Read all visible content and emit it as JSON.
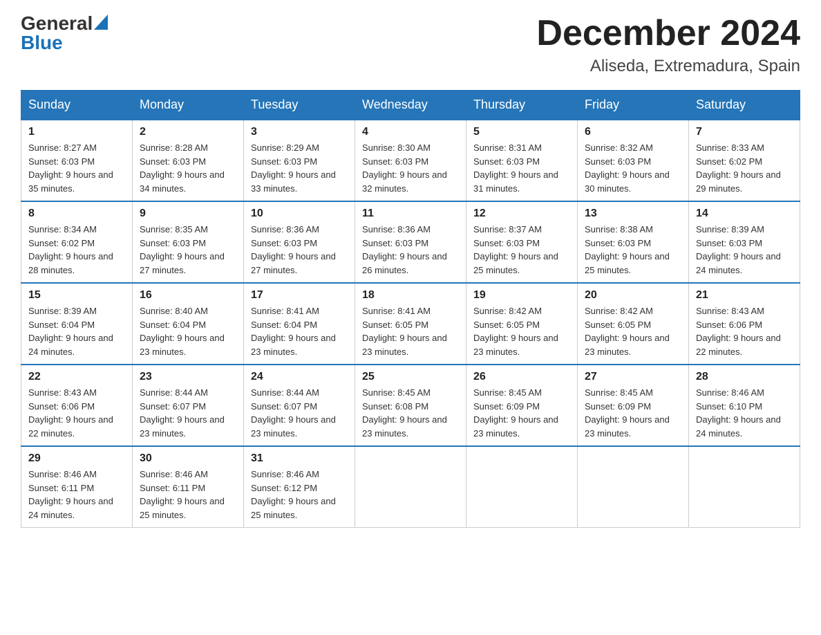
{
  "header": {
    "logo_general": "General",
    "logo_blue": "Blue",
    "month_title": "December 2024",
    "location": "Aliseda, Extremadura, Spain"
  },
  "days_of_week": [
    "Sunday",
    "Monday",
    "Tuesday",
    "Wednesday",
    "Thursday",
    "Friday",
    "Saturday"
  ],
  "weeks": [
    [
      {
        "day": "1",
        "sunrise": "8:27 AM",
        "sunset": "6:03 PM",
        "daylight": "9 hours and 35 minutes."
      },
      {
        "day": "2",
        "sunrise": "8:28 AM",
        "sunset": "6:03 PM",
        "daylight": "9 hours and 34 minutes."
      },
      {
        "day": "3",
        "sunrise": "8:29 AM",
        "sunset": "6:03 PM",
        "daylight": "9 hours and 33 minutes."
      },
      {
        "day": "4",
        "sunrise": "8:30 AM",
        "sunset": "6:03 PM",
        "daylight": "9 hours and 32 minutes."
      },
      {
        "day": "5",
        "sunrise": "8:31 AM",
        "sunset": "6:03 PM",
        "daylight": "9 hours and 31 minutes."
      },
      {
        "day": "6",
        "sunrise": "8:32 AM",
        "sunset": "6:03 PM",
        "daylight": "9 hours and 30 minutes."
      },
      {
        "day": "7",
        "sunrise": "8:33 AM",
        "sunset": "6:02 PM",
        "daylight": "9 hours and 29 minutes."
      }
    ],
    [
      {
        "day": "8",
        "sunrise": "8:34 AM",
        "sunset": "6:02 PM",
        "daylight": "9 hours and 28 minutes."
      },
      {
        "day": "9",
        "sunrise": "8:35 AM",
        "sunset": "6:03 PM",
        "daylight": "9 hours and 27 minutes."
      },
      {
        "day": "10",
        "sunrise": "8:36 AM",
        "sunset": "6:03 PM",
        "daylight": "9 hours and 27 minutes."
      },
      {
        "day": "11",
        "sunrise": "8:36 AM",
        "sunset": "6:03 PM",
        "daylight": "9 hours and 26 minutes."
      },
      {
        "day": "12",
        "sunrise": "8:37 AM",
        "sunset": "6:03 PM",
        "daylight": "9 hours and 25 minutes."
      },
      {
        "day": "13",
        "sunrise": "8:38 AM",
        "sunset": "6:03 PM",
        "daylight": "9 hours and 25 minutes."
      },
      {
        "day": "14",
        "sunrise": "8:39 AM",
        "sunset": "6:03 PM",
        "daylight": "9 hours and 24 minutes."
      }
    ],
    [
      {
        "day": "15",
        "sunrise": "8:39 AM",
        "sunset": "6:04 PM",
        "daylight": "9 hours and 24 minutes."
      },
      {
        "day": "16",
        "sunrise": "8:40 AM",
        "sunset": "6:04 PM",
        "daylight": "9 hours and 23 minutes."
      },
      {
        "day": "17",
        "sunrise": "8:41 AM",
        "sunset": "6:04 PM",
        "daylight": "9 hours and 23 minutes."
      },
      {
        "day": "18",
        "sunrise": "8:41 AM",
        "sunset": "6:05 PM",
        "daylight": "9 hours and 23 minutes."
      },
      {
        "day": "19",
        "sunrise": "8:42 AM",
        "sunset": "6:05 PM",
        "daylight": "9 hours and 23 minutes."
      },
      {
        "day": "20",
        "sunrise": "8:42 AM",
        "sunset": "6:05 PM",
        "daylight": "9 hours and 23 minutes."
      },
      {
        "day": "21",
        "sunrise": "8:43 AM",
        "sunset": "6:06 PM",
        "daylight": "9 hours and 22 minutes."
      }
    ],
    [
      {
        "day": "22",
        "sunrise": "8:43 AM",
        "sunset": "6:06 PM",
        "daylight": "9 hours and 22 minutes."
      },
      {
        "day": "23",
        "sunrise": "8:44 AM",
        "sunset": "6:07 PM",
        "daylight": "9 hours and 23 minutes."
      },
      {
        "day": "24",
        "sunrise": "8:44 AM",
        "sunset": "6:07 PM",
        "daylight": "9 hours and 23 minutes."
      },
      {
        "day": "25",
        "sunrise": "8:45 AM",
        "sunset": "6:08 PM",
        "daylight": "9 hours and 23 minutes."
      },
      {
        "day": "26",
        "sunrise": "8:45 AM",
        "sunset": "6:09 PM",
        "daylight": "9 hours and 23 minutes."
      },
      {
        "day": "27",
        "sunrise": "8:45 AM",
        "sunset": "6:09 PM",
        "daylight": "9 hours and 23 minutes."
      },
      {
        "day": "28",
        "sunrise": "8:46 AM",
        "sunset": "6:10 PM",
        "daylight": "9 hours and 24 minutes."
      }
    ],
    [
      {
        "day": "29",
        "sunrise": "8:46 AM",
        "sunset": "6:11 PM",
        "daylight": "9 hours and 24 minutes."
      },
      {
        "day": "30",
        "sunrise": "8:46 AM",
        "sunset": "6:11 PM",
        "daylight": "9 hours and 25 minutes."
      },
      {
        "day": "31",
        "sunrise": "8:46 AM",
        "sunset": "6:12 PM",
        "daylight": "9 hours and 25 minutes."
      },
      null,
      null,
      null,
      null
    ]
  ]
}
